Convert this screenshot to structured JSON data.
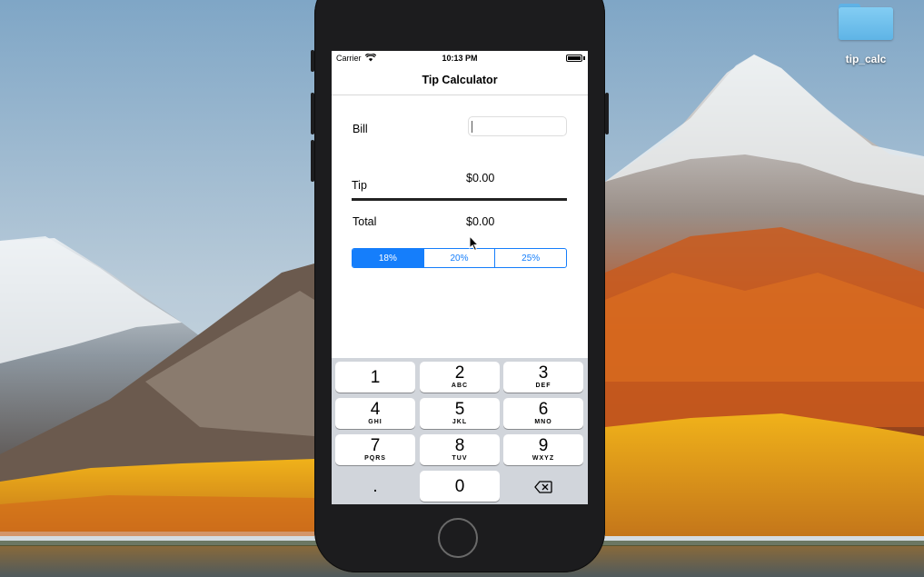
{
  "desktop": {
    "folder_label": "tip_calc"
  },
  "status_bar": {
    "carrier": "Carrier",
    "time": "10:13 PM"
  },
  "nav": {
    "title": "Tip Calculator"
  },
  "form": {
    "bill_label": "Bill",
    "bill_value": "",
    "tip_label": "Tip",
    "tip_value": "$0.00",
    "total_label": "Total",
    "total_value": "$0.00"
  },
  "tip_segments": {
    "options": [
      "18%",
      "20%",
      "25%"
    ],
    "selected": "18%"
  },
  "keypad": {
    "keys": [
      {
        "num": "1",
        "letters": ""
      },
      {
        "num": "2",
        "letters": "ABC"
      },
      {
        "num": "3",
        "letters": "DEF"
      },
      {
        "num": "4",
        "letters": "GHI"
      },
      {
        "num": "5",
        "letters": "JKL"
      },
      {
        "num": "6",
        "letters": "MNO"
      },
      {
        "num": "7",
        "letters": "PQRS"
      },
      {
        "num": "8",
        "letters": "TUV"
      },
      {
        "num": "9",
        "letters": "WXYZ"
      },
      {
        "num": ".",
        "letters": ""
      },
      {
        "num": "0",
        "letters": ""
      }
    ]
  },
  "colors": {
    "accent": "#157efb",
    "keypad_bg": "#d1d5db"
  }
}
